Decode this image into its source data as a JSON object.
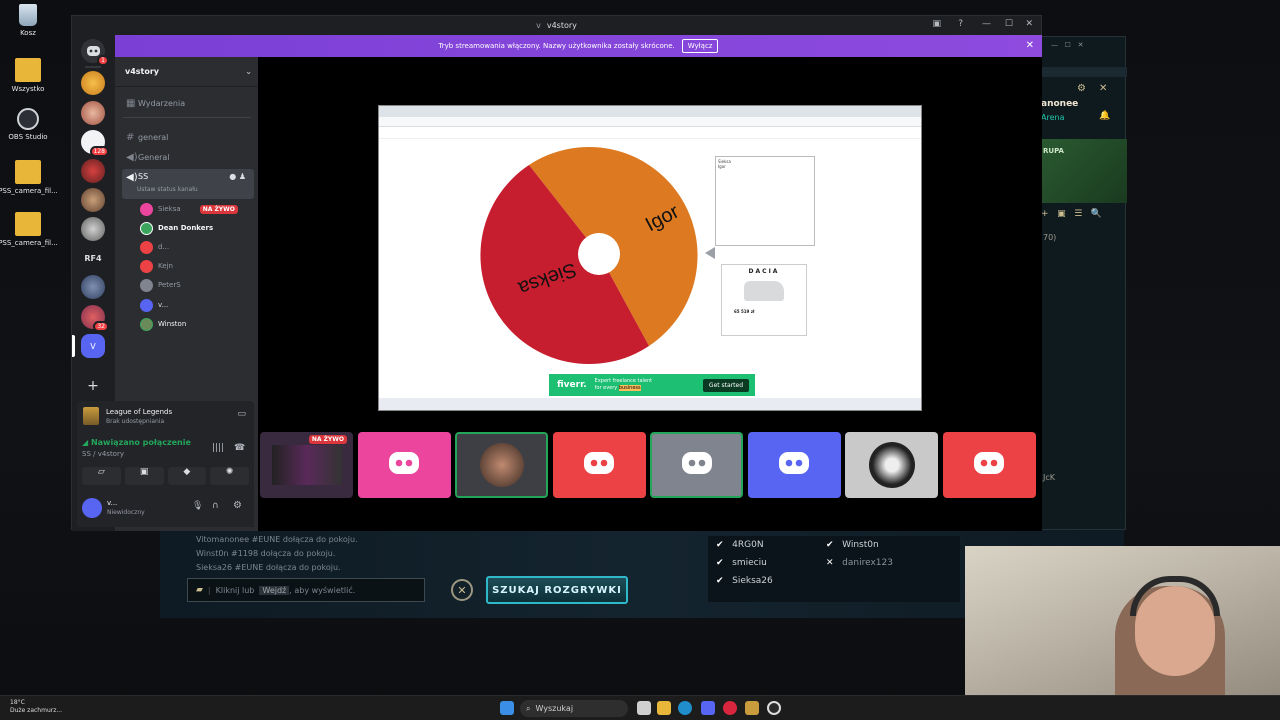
{
  "desktop": {
    "icons": [
      {
        "label": "Kosz",
        "icon": "recycle-bin-icon"
      },
      {
        "label": "Wszystko",
        "icon": "folder-icon"
      },
      {
        "label": "OBS Studio",
        "icon": "obs-icon"
      },
      {
        "label": "PSS_camera_fil...",
        "icon": "folder-icon"
      },
      {
        "label": "PSS_camera_fil...",
        "icon": "folder-icon"
      }
    ]
  },
  "window": {
    "title": "v4story"
  },
  "banner": {
    "text": "Tryb streamowania włączony. Nazwy użytkownika zostały skrócone.",
    "button": "Wyłącz"
  },
  "guilds": {
    "badges": [
      "1",
      "128",
      "32"
    ],
    "rf4_label": "RF4",
    "selected_label": "V"
  },
  "server": {
    "name": "v4story",
    "events": "Wydarzenia",
    "channels": [
      {
        "name": "general",
        "type": "text"
      },
      {
        "name": "General",
        "type": "voice"
      },
      {
        "name": "SS",
        "type": "voice",
        "status": "Ustaw status kanału"
      }
    ],
    "voice_users": [
      {
        "name": "Sieksa",
        "live": "NA ŻYWO"
      },
      {
        "name": "Dean Donkers"
      },
      {
        "name": "d..."
      },
      {
        "name": "Kejn"
      },
      {
        "name": "PeterS"
      },
      {
        "name": "v..."
      },
      {
        "name": "Winston"
      }
    ]
  },
  "activity": {
    "game": "League of Legends",
    "sub": "Brak udostępniania"
  },
  "voice_status": {
    "connected": "Nawiązano połączenie",
    "location": "SS / v4story"
  },
  "user": {
    "name": "v...",
    "status": "Niewidoczny"
  },
  "stream": {
    "wheel": {
      "labels": [
        "Igor",
        "Sieksa"
      ],
      "colors": [
        "#dd7a21",
        "#c61e2e"
      ]
    },
    "note_lines": [
      "Sieksa",
      "Igor"
    ],
    "dacia": {
      "brand": "DACIA",
      "price": "65 519 zł"
    },
    "fiverr": {
      "logo": "fiverr.",
      "line1": "Expert freelance talent",
      "line2": "for every ",
      "highlight": "business",
      "button": "Get started"
    },
    "live_badge": "NA ŻYWO"
  },
  "participants": [
    {
      "type": "screen",
      "color": "#3a2a40"
    },
    {
      "type": "discord",
      "color": "#eb459e"
    },
    {
      "type": "camera",
      "color": "#3d3f45"
    },
    {
      "type": "discord",
      "color": "#ed4245"
    },
    {
      "type": "discord",
      "color": "#80848e"
    },
    {
      "type": "discord",
      "color": "#5865f2"
    },
    {
      "type": "avatar",
      "color": "#c9c9c9"
    },
    {
      "type": "discord",
      "color": "#ed4245"
    }
  ],
  "lol": {
    "right_partial": [
      "anonee",
      "Arena",
      "RUPA",
      "70)",
      "JcK"
    ],
    "chat": [
      "Vitomanonee #EUNE dołącza do pokoju.",
      "Winst0n #1198 dołącza do pokoju.",
      "Sieksa26 #EUNE dołącza do pokoju."
    ],
    "chat_placeholder_pre": "Kliknij lub",
    "chat_placeholder_key": "Wejdź",
    "chat_placeholder_post": ", aby wyświetlić.",
    "find_match": "SZUKAJ ROZGRYWKI",
    "players": [
      {
        "name": "4RG0N",
        "ready": true
      },
      {
        "name": "Winst0n",
        "ready": true
      },
      {
        "name": "smieciu",
        "ready": true
      },
      {
        "name": "danirex123",
        "ready": false
      },
      {
        "name": "Sieksa26",
        "ready": true
      }
    ]
  },
  "taskbar": {
    "weather_temp": "18°C",
    "weather_desc": "Duże zachmurz...",
    "search": "Wyszukaj"
  },
  "colors": {
    "blurple": "#5865f2",
    "red": "#da373c",
    "green": "#23a55a",
    "banner": "#8e4bde"
  }
}
